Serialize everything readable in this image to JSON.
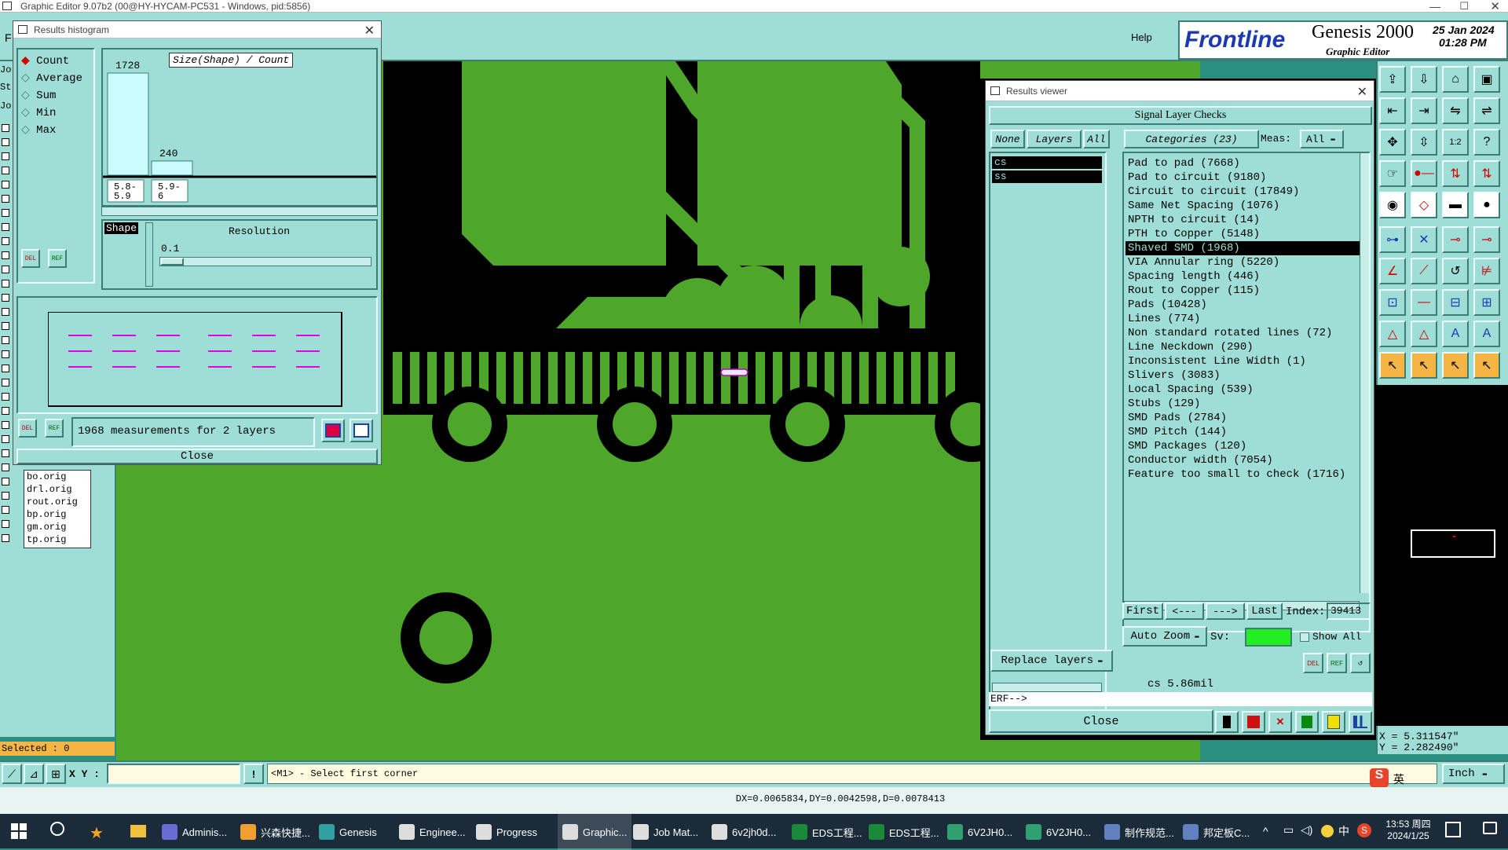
{
  "app": {
    "title": "Graphic Editor 9.07b2 (00@HY-HYCAM-PC531 - Windows, pid:5856)",
    "help": "Help",
    "brand": "Frontline",
    "product": "Genesis 2000",
    "subtitle": "Graphic Editor",
    "date": "25 Jan 2024",
    "time": "01:28 PM",
    "menu_f": "F"
  },
  "left_panel": {
    "tabs": [
      "Jo",
      "St",
      "Jo"
    ],
    "layers": [
      "bo.orig",
      "drl.orig",
      "rout.orig",
      "bp.orig",
      "gm.orig",
      "tp.orig"
    ],
    "selected": "Selected : 0"
  },
  "histogram": {
    "title": "Results histogram",
    "options": [
      "Count",
      "Average",
      "Sum",
      "Min",
      "Max"
    ],
    "axis_title": "Size(Shape) / Count",
    "bars": [
      {
        "label": "1728",
        "value": 1728,
        "cat": "5.8-5.9"
      },
      {
        "label": "240",
        "value": 240,
        "cat": "5.9-6"
      }
    ],
    "cat_labels": [
      "5.8-\n5.9",
      "5.9-\n6"
    ],
    "shape_label": "Shape",
    "resolution_label": "Resolution",
    "resolution_value": "0.1",
    "status": "1968 measurements for 2 layers",
    "close": "Close",
    "del": "DEL",
    "ref": "REF"
  },
  "results_viewer": {
    "title": "Results viewer",
    "header": "Signal Layer Checks",
    "btn_none": "None",
    "btn_layers": "Layers",
    "btn_all": "All",
    "categories_label": "Categories (23)",
    "meas_label": "Meas:",
    "meas_value": "All",
    "layers": [
      "cs",
      "ss"
    ],
    "categories": [
      "Pad to pad (7668)",
      "Pad to circuit (9180)",
      "Circuit to circuit (17849)",
      "Same Net Spacing (1076)",
      "NPTH to circuit (14)",
      "PTH to Copper (5148)",
      "Shaved SMD (1968)",
      "VIA Annular ring (5220)",
      "Spacing length (446)",
      "Rout to Copper (115)",
      "Pads (10428)",
      "Lines (774)",
      "Non standard rotated lines (72)",
      "Line Neckdown (290)",
      "Inconsistent Line Width (1)",
      "Slivers (3083)",
      "Local Spacing (539)",
      "Stubs (129)",
      "SMD Pads (2784)",
      "SMD Pitch (144)",
      "SMD Packages (120)",
      "Conductor width (7054)",
      "Feature too small to check (1716)"
    ],
    "selected_index": 6,
    "nav": {
      "first": "First",
      "prev": "<---",
      "next": "--->",
      "last": "Last",
      "index_label": "Index:",
      "index_value": "39413"
    },
    "auto_zoom": "Auto Zoom",
    "sv_label": "Sv:",
    "show_all": "Show All",
    "replace_layers": "Replace layers",
    "measure_readout": "cs 5.86mil",
    "erf": "ERF-->",
    "close": "Close"
  },
  "coords": {
    "x": "X = 5.311547\"",
    "y": "Y = 2.282490\""
  },
  "command_bar": {
    "xy_label": "X Y :",
    "prompt": "<M1> - Select first corner",
    "units": "Inch"
  },
  "delta_readout": "DX=0.0065834,DY=0.0042598,D=0.0078413",
  "taskbar": {
    "items": [
      "Adminis...",
      "兴森快捷...",
      "Genesis",
      "Enginee...",
      "Progress",
      "Graphic...",
      "Job Mat...",
      "6v2jh0d...",
      "EDS工程...",
      "EDS工程...",
      "6V2JH0...",
      "6V2JH0...",
      "制作规范...",
      "邦定板C..."
    ],
    "clock_time": "13:53 周四",
    "clock_date": "2024/1/25",
    "ime": "中",
    "ime2": "英"
  },
  "colors": {
    "pcb_green": "#4ea62a",
    "copper_black": "#000000",
    "ui_teal": "#9fded6",
    "highlight": "#000000",
    "accent_magenta": "#e000e0"
  }
}
